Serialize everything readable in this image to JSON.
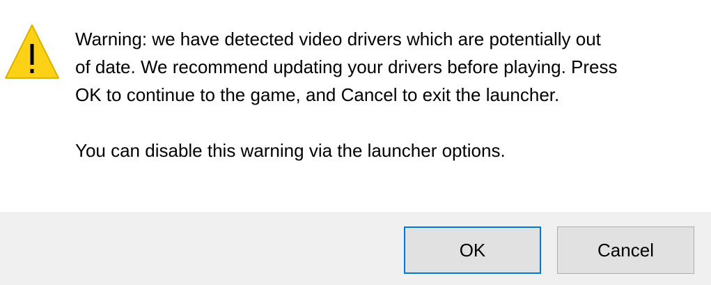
{
  "dialog": {
    "icon": "warning-triangle-icon",
    "accent_colors": {
      "icon_fill": "#fcd116",
      "icon_stroke": "#d8b300",
      "default_button_border": "#0078d7",
      "button_bar": "#f0f0f0"
    },
    "message_lines": [
      "Warning: we have detected video drivers which are potentially out",
      "of date. We recommend updating your drivers before playing. Press",
      "OK to continue to the game, and Cancel to exit the launcher."
    ],
    "secondary_message": "You can disable this warning via the launcher options.",
    "buttons": {
      "ok_label": "OK",
      "cancel_label": "Cancel"
    }
  }
}
